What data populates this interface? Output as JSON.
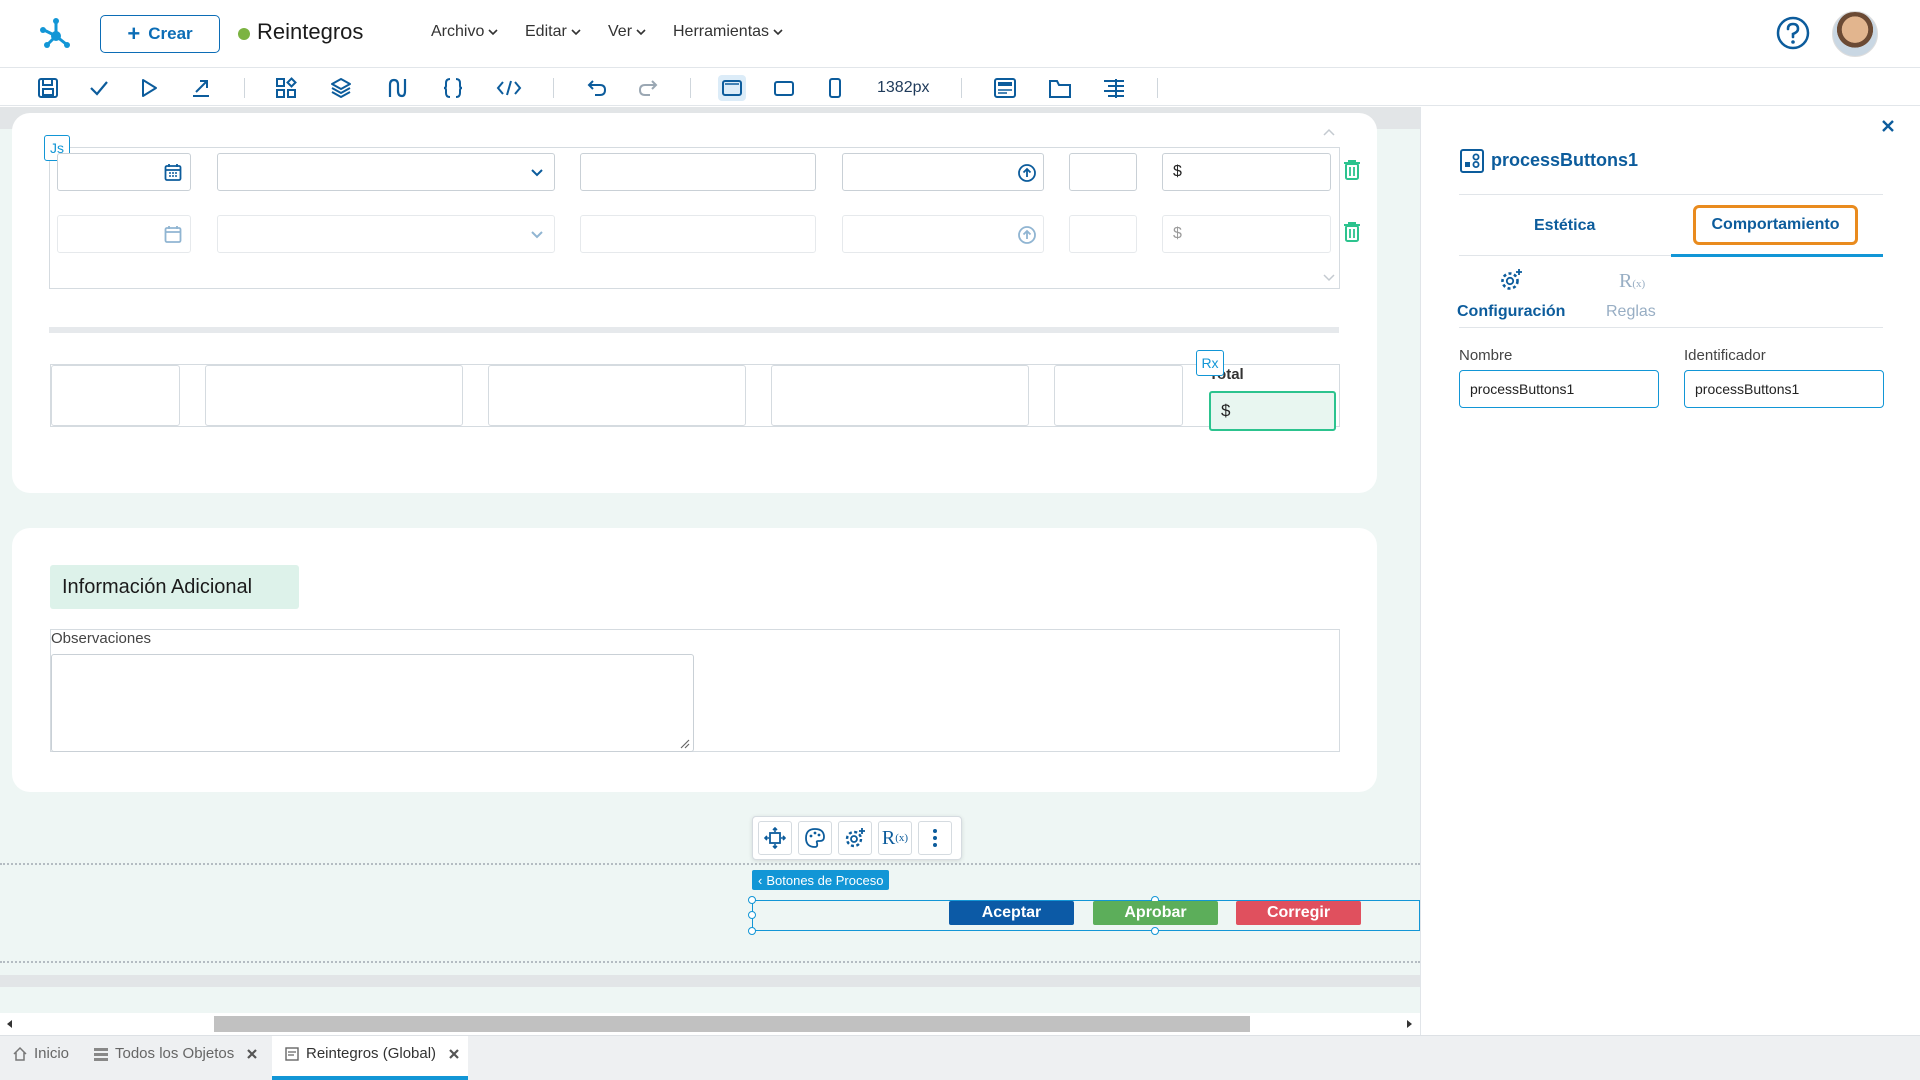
{
  "header": {
    "create_label": "Crear",
    "app_title": "Reintegros",
    "menu": [
      "Archivo",
      "Editar",
      "Ver",
      "Herramientas"
    ],
    "help_icon": "question-circle-icon",
    "avatar_icon": "user-avatar"
  },
  "toolbar": {
    "width_readout": "1382px",
    "icons": [
      "save-icon",
      "check-icon",
      "play-icon",
      "export-icon",
      "widgets-icon",
      "layers-icon",
      "flow-icon",
      "braces-icon",
      "code-icon",
      "undo-icon",
      "redo-icon",
      "desktop-view-icon",
      "tablet-view-icon",
      "mobile-view-icon",
      "header-icon",
      "tabs-icon",
      "align-icon"
    ]
  },
  "canvas": {
    "js_badge": "Js",
    "rx_badge": "Rx",
    "currency_symbol": "$",
    "total_label": "Total",
    "section_title": "Información Adicional",
    "observaciones_label": "Observaciones",
    "process_buttons_tag": "Botones de Proceso",
    "buttons": {
      "aceptar": "Aceptar",
      "aprobar": "Aprobar",
      "corregir": "Corregir"
    },
    "colors": {
      "aceptar": "#0c5aa6",
      "aprobar": "#5cae5a",
      "corregir": "#e0505e",
      "accent": "#1296d6",
      "highlight": "#2cc38e"
    }
  },
  "panel": {
    "title": "processButtons1",
    "tabs": {
      "estetica": "Estética",
      "comportamiento": "Comportamiento"
    },
    "subtabs": {
      "configuracion": "Configuración",
      "reglas": "Reglas"
    },
    "fields": {
      "nombre_label": "Nombre",
      "nombre_value": "processButtons1",
      "identificador_label": "Identificador",
      "identificador_value": "processButtons1"
    },
    "highlight_color": "#e98b1e"
  },
  "bottom_tabs": [
    {
      "label": "Inicio"
    },
    {
      "label": "Todos los Objetos"
    },
    {
      "label": "Reintegros (Global)"
    }
  ]
}
